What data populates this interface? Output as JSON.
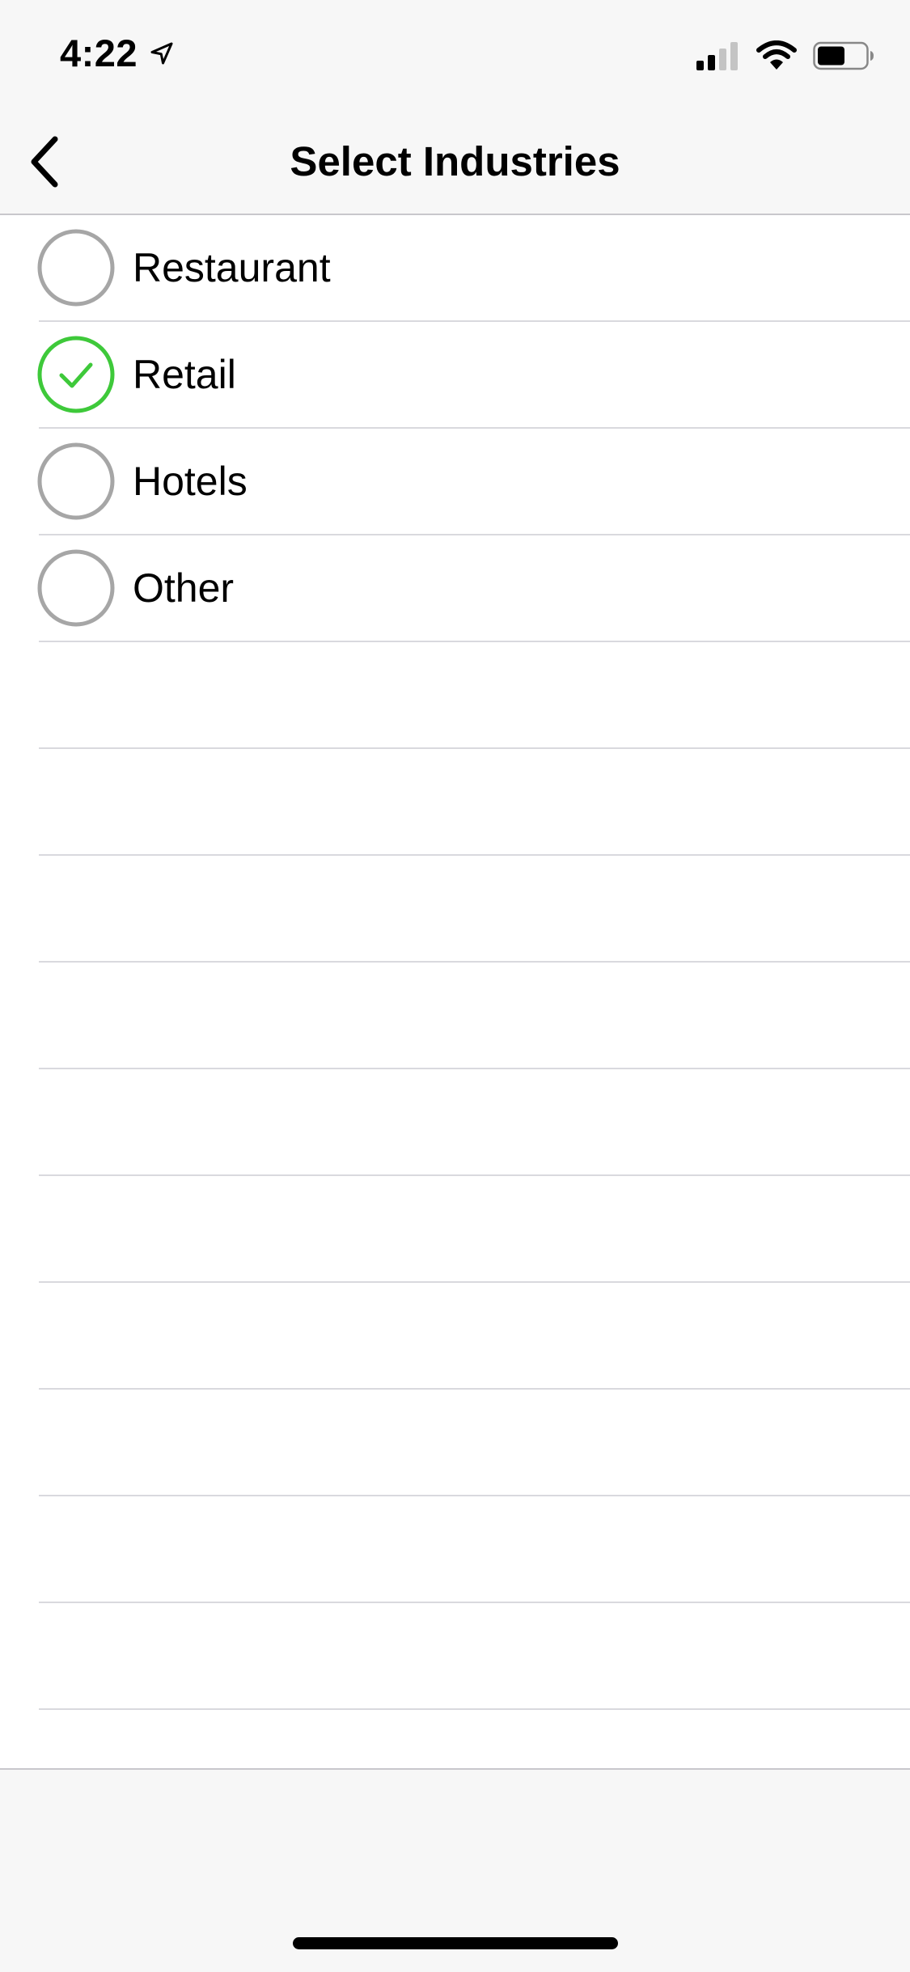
{
  "status_bar": {
    "time": "4:22",
    "location_icon": "location-arrow-icon",
    "signal_icon": "cellular-signal-icon",
    "wifi_icon": "wifi-icon",
    "battery_icon": "battery-icon",
    "battery_level": 0.5
  },
  "nav": {
    "title": "Select Industries",
    "back_icon": "chevron-left-icon"
  },
  "industries": [
    {
      "label": "Restaurant",
      "selected": false
    },
    {
      "label": "Retail",
      "selected": true
    },
    {
      "label": "Hotels",
      "selected": false
    },
    {
      "label": "Other",
      "selected": false
    }
  ],
  "colors": {
    "selected": "#3ec93a",
    "unselected": "#a6a6a6",
    "separator": "#d9d9de"
  }
}
